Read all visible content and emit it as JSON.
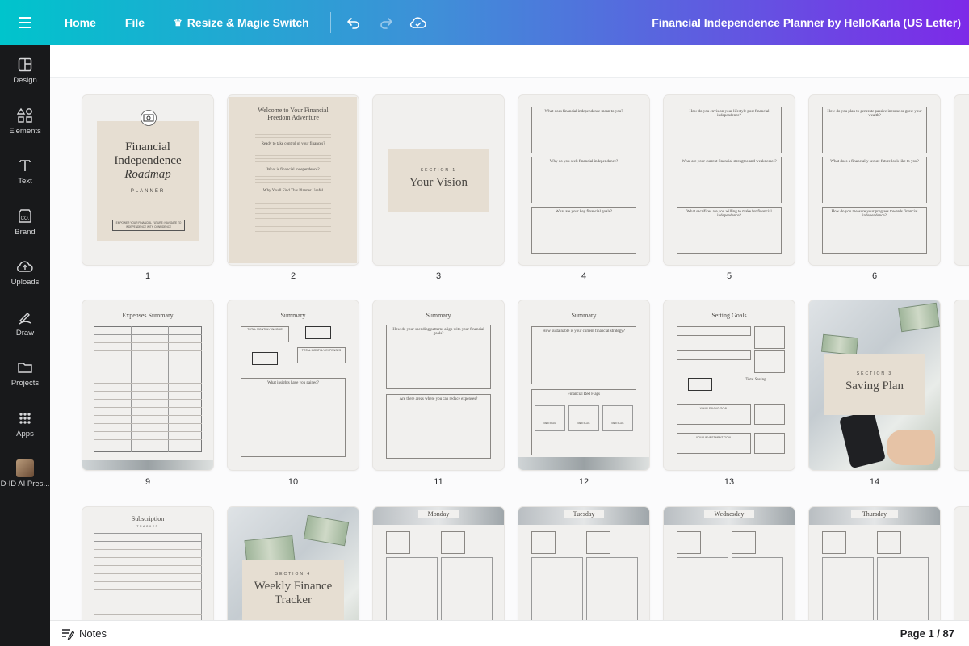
{
  "topbar": {
    "home": "Home",
    "file": "File",
    "resize": "Resize & Magic Switch",
    "doc_title": "Financial Independence Planner by HelloKarla (US Letter)"
  },
  "sidebar": {
    "items": [
      {
        "label": "Design",
        "icon": "design-icon"
      },
      {
        "label": "Elements",
        "icon": "elements-icon"
      },
      {
        "label": "Text",
        "icon": "text-icon"
      },
      {
        "label": "Brand",
        "icon": "brand-icon"
      },
      {
        "label": "Uploads",
        "icon": "uploads-icon"
      },
      {
        "label": "Draw",
        "icon": "draw-icon"
      },
      {
        "label": "Projects",
        "icon": "projects-icon"
      },
      {
        "label": "Apps",
        "icon": "apps-icon"
      },
      {
        "label": "D-ID AI Pres...",
        "icon": "avatar-icon"
      }
    ]
  },
  "pages": {
    "numbers": [
      "1",
      "2",
      "3",
      "4",
      "5",
      "6",
      "9",
      "10",
      "11",
      "12",
      "13",
      "14"
    ],
    "p1": {
      "title": "Financial Independence",
      "script": "Roadmap",
      "sub": "PLANNER",
      "tag": "EMPOWER YOUR FINANCIAL FUTURE: NAVIGATE TO INDEPENDENCE WITH CONFIDENCE"
    },
    "p2": {
      "title": "Welcome to Your Financial Freedom Adventure",
      "q1": "Ready to take control of your finances?",
      "q2": "What is financial independence?",
      "q3": "Why You'll Find This Planner Useful"
    },
    "p3": {
      "section": "SECTION 1",
      "title": "Your Vision"
    },
    "p4": {
      "q1": "What does financial independence mean to you?",
      "q2": "Why do you seek financial independence?",
      "q3": "What are your key financial goals?"
    },
    "p5": {
      "q1": "How do you envision your lifestyle post financial independence?",
      "q2": "What are your current financial strengths and weaknesses?",
      "q3": "What sacrifices are you willing to make for financial independence?"
    },
    "p6": {
      "q1": "How do you plan to generate passive income or grow your wealth?",
      "q2": "What does a financially secure future look like to you?",
      "q3": "How do you measure your progress towards financial independence?"
    },
    "p9": {
      "title": "Expenses Summary"
    },
    "p10": {
      "title": "Summary",
      "label1": "TOTAL MONTHLY INCOME",
      "label2": "TOTAL MONTHLY EXPENSES",
      "q": "What insights have you gained?"
    },
    "p11": {
      "title": "Summary",
      "q1": "How do your spending patterns align with your financial goals?",
      "q2": "Are there areas where you can reduce expenses?"
    },
    "p12": {
      "title": "Summary",
      "q1": "How sustainable is your current financial strategy?",
      "q2": "Financial Red Flags",
      "flag": "RED FLAG"
    },
    "p13": {
      "title": "Setting Goals",
      "total": "Total Saving",
      "saving": "YOUR SAVING GOAL",
      "invest": "YOUR INVESTMENT GOAL"
    },
    "p14": {
      "section": "SECTION 3",
      "title": "Saving Plan"
    },
    "r3": [
      {
        "title": "Subscription",
        "sub": "TRACKER"
      },
      {
        "section": "SECTION 4",
        "title": "Weekly Finance Tracker"
      },
      {
        "title": "Monday"
      },
      {
        "title": "Tuesday"
      },
      {
        "title": "Wednesday"
      },
      {
        "title": "Thursday"
      }
    ]
  },
  "bottombar": {
    "notes": "Notes",
    "page_count": "Page 1 / 87"
  },
  "colors": {
    "gradient_start": "#00c4cc",
    "gradient_end": "#7d2ae8",
    "sidebar": "#18191b",
    "page_beige": "#e6ded2"
  }
}
